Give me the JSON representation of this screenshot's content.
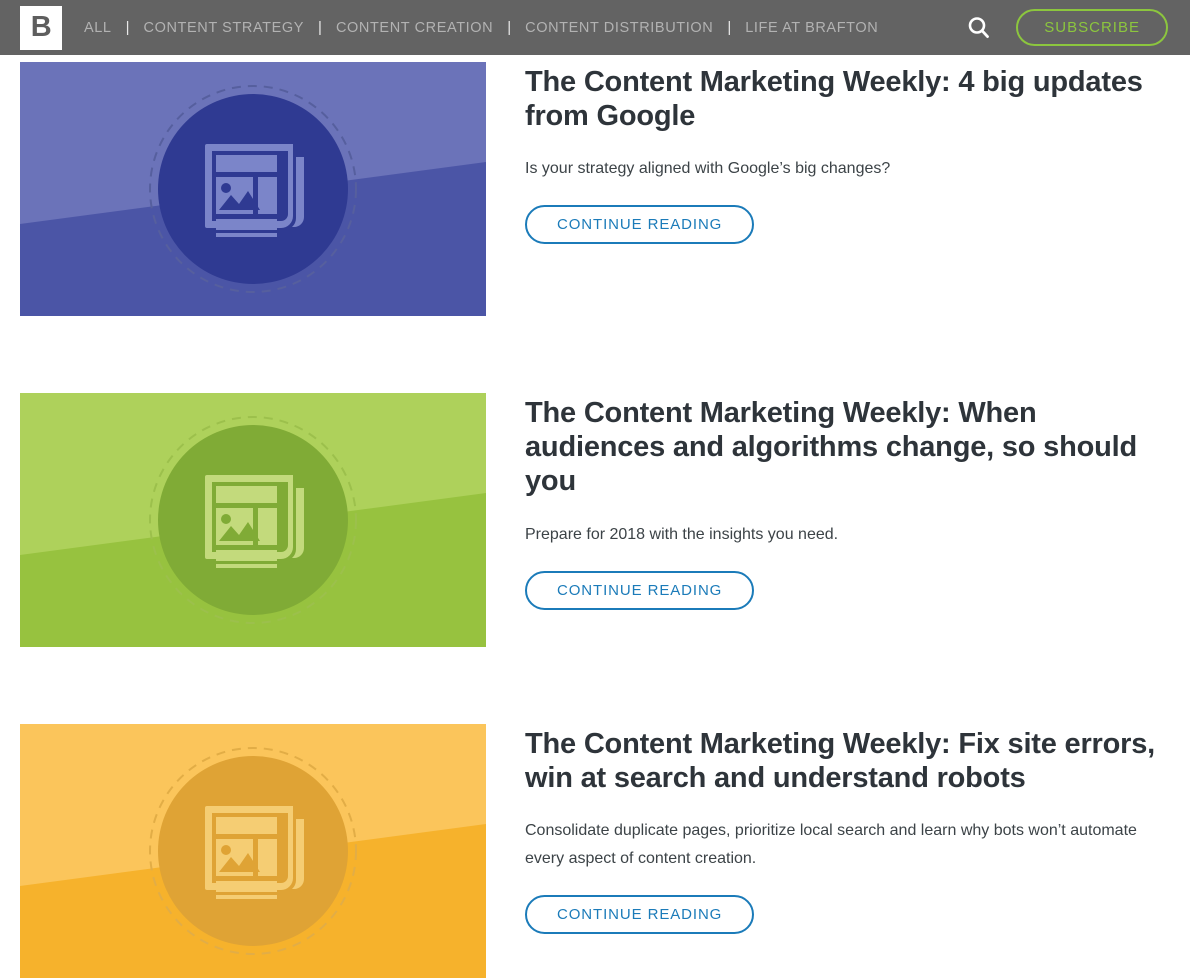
{
  "header": {
    "logo_letter": "B",
    "logo_name": "brafton-logo",
    "nav_items": [
      {
        "label": "ALL"
      },
      {
        "label": "CONTENT STRATEGY"
      },
      {
        "label": "CONTENT CREATION"
      },
      {
        "label": "CONTENT DISTRIBUTION"
      },
      {
        "label": "LIFE AT BRAFTON"
      }
    ],
    "separator": "|",
    "search_icon": "search-icon",
    "subscribe_label": "SUBSCRIBE",
    "colors": {
      "bar": "#636363",
      "nav_text": "#b2b2b2",
      "subscribe_accent": "#8cc63e",
      "logo_bg": "#ffffff"
    }
  },
  "posts": [
    {
      "title": "The Content Marketing Weekly: 4 big updates from Google",
      "excerpt": "Is your strategy aligned with Google’s big changes?",
      "cta_label": "CONTINUE READING",
      "thumb_icon": "newspaper-icon",
      "colors": {
        "bg_top": "#6b73b9",
        "bg_bottom": "#4b55a6",
        "circle": "#2f3a92",
        "icon": "#7b85c9",
        "dash": "#565f9e"
      }
    },
    {
      "title": "The Content Marketing Weekly: When audiences and algorithms change, so should you",
      "excerpt": "Prepare for 2018 with the insights you need.",
      "cta_label": "CONTINUE READING",
      "thumb_icon": "newspaper-icon",
      "colors": {
        "bg_top": "#aed15b",
        "bg_bottom": "#97c23f",
        "circle": "#80ab36",
        "icon": "#c3da7c",
        "dash": "#9cc04c"
      }
    },
    {
      "title": "The Content Marketing Weekly: Fix site errors, win at search and understand robots",
      "excerpt": "Consolidate duplicate pages, prioritize local search and learn why bots won’t automate every aspect of content creation.",
      "cta_label": "CONTINUE READING",
      "thumb_icon": "newspaper-icon",
      "colors": {
        "bg_top": "#fbc55b",
        "bg_bottom": "#f6b22c",
        "circle": "#dfa335",
        "icon": "#f5cd73",
        "dash": "#e2ad46"
      }
    }
  ],
  "cta_color": "#1b7bb9",
  "title_color": "#2e343a"
}
